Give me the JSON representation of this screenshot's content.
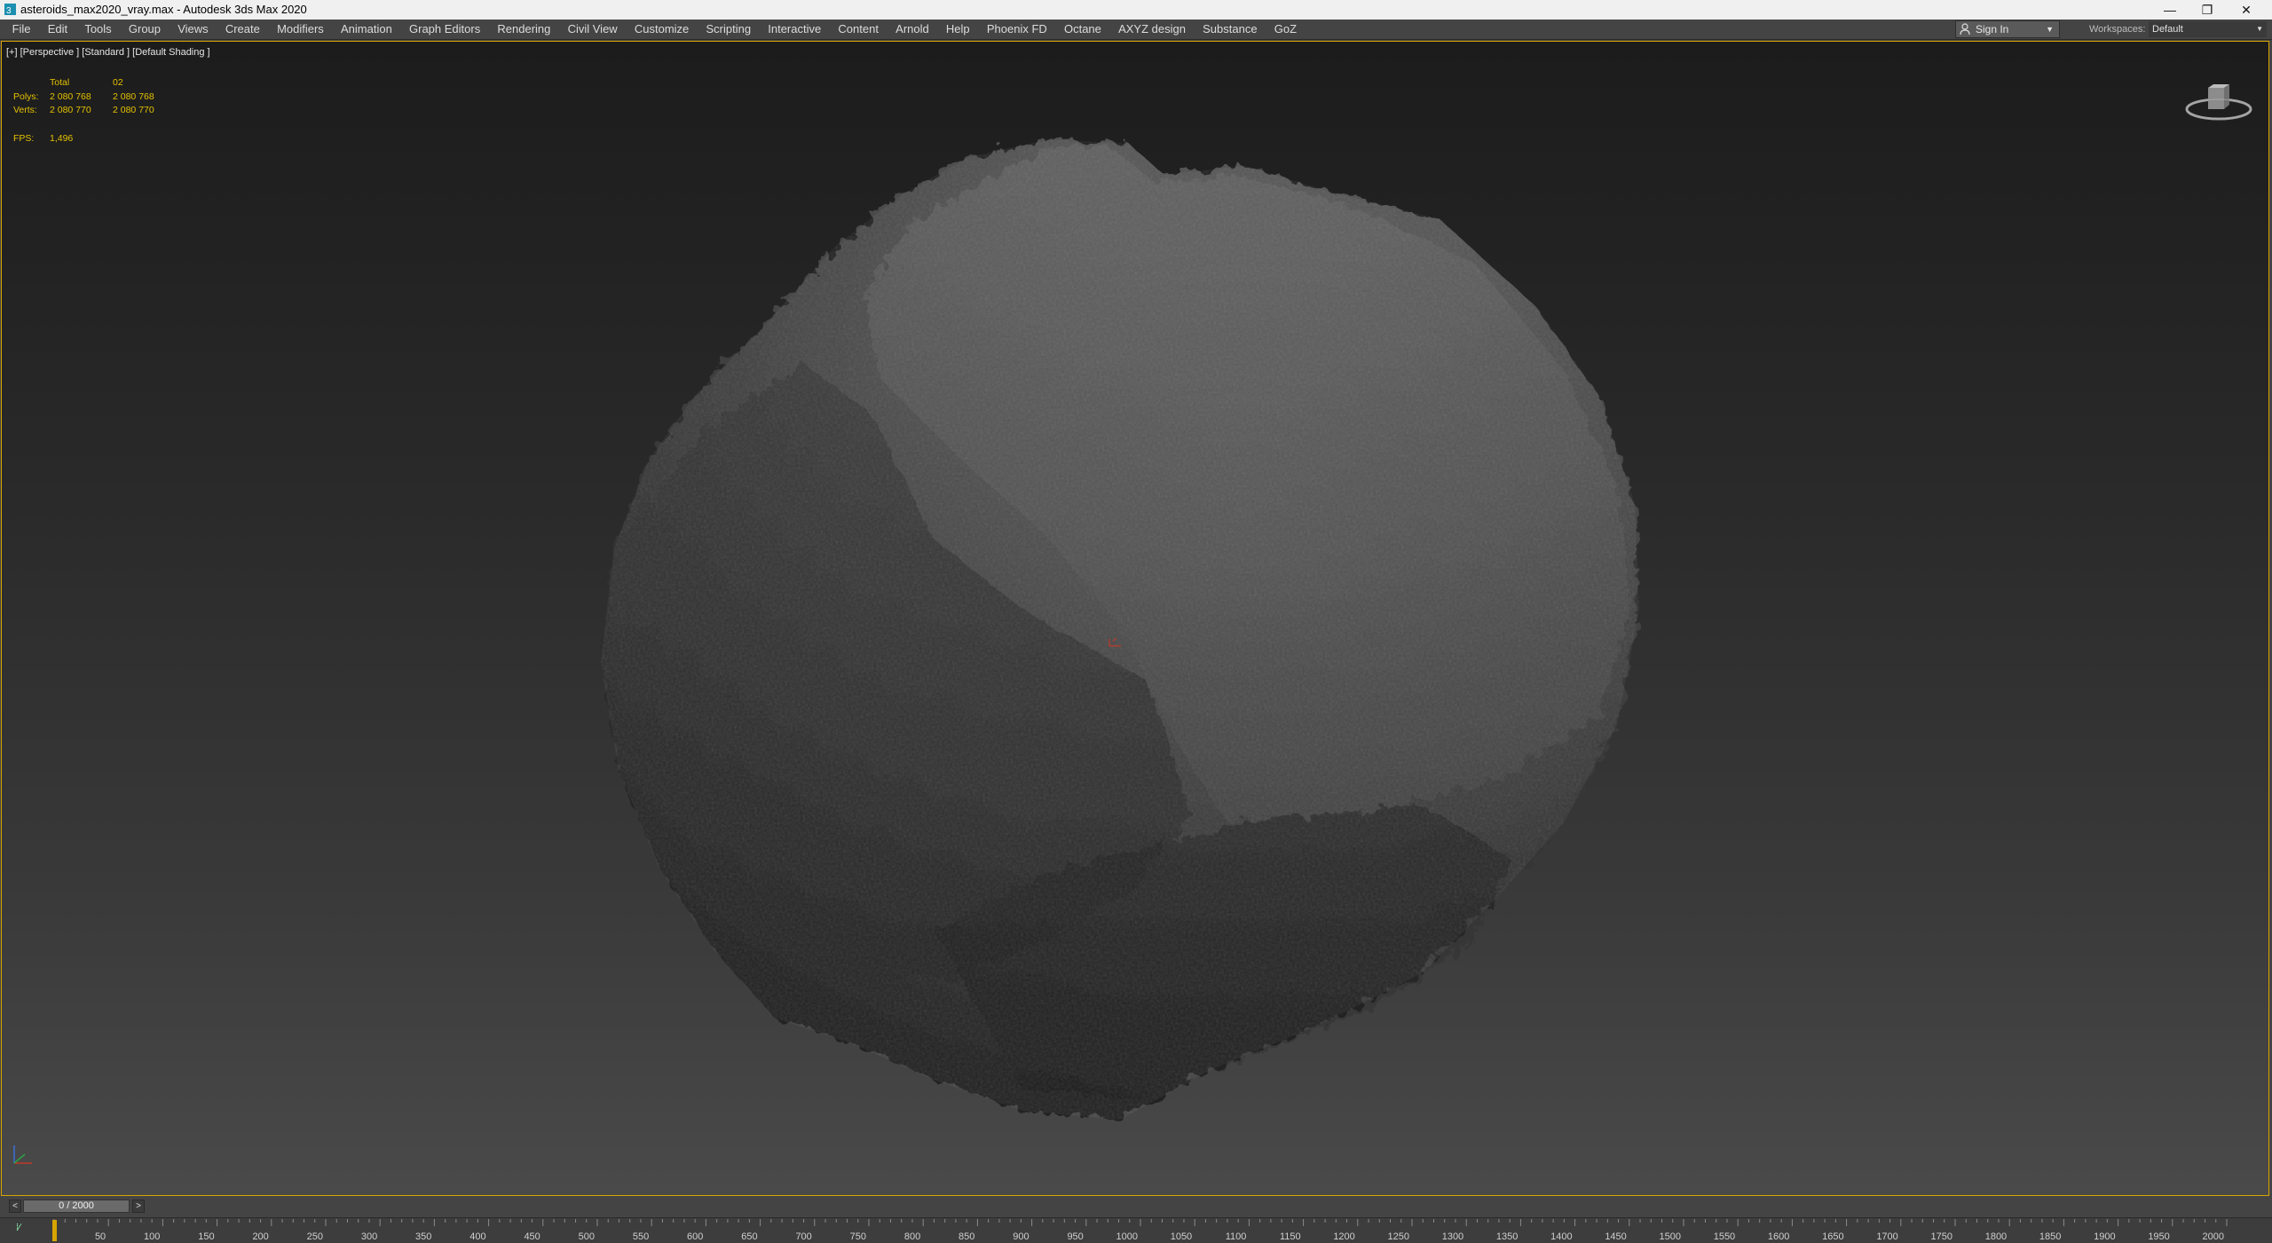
{
  "window": {
    "title": "asteroids_max2020_vray.max - Autodesk 3ds Max 2020",
    "controls": {
      "minimize": "—",
      "restore": "❐",
      "close": "✕"
    }
  },
  "menubar": {
    "items": [
      "File",
      "Edit",
      "Tools",
      "Group",
      "Views",
      "Create",
      "Modifiers",
      "Animation",
      "Graph Editors",
      "Rendering",
      "Civil View",
      "Customize",
      "Scripting",
      "Interactive",
      "Content",
      "Arnold",
      "Help",
      "Phoenix FD",
      "Octane",
      "AXYZ design",
      "Substance",
      "GoZ"
    ],
    "signin": {
      "label": "Sign In",
      "icon": "user-icon"
    },
    "workspaces": {
      "label": "Workspaces:",
      "value": "Default"
    }
  },
  "viewport": {
    "label": "[+] [Perspective ] [Standard ] [Default Shading ]",
    "stats": {
      "header_total": "Total",
      "header_object": "02",
      "polys_label": "Polys:",
      "polys_total": "2 080 768",
      "polys_object": "2 080 768",
      "verts_label": "Verts:",
      "verts_total": "2 080 770",
      "verts_object": "2 080 770",
      "fps_label": "FPS:",
      "fps_value": "1,496"
    },
    "colors": {
      "border": "#d7a400",
      "stats": "#e5c100",
      "rock": "#555555"
    }
  },
  "timeslider": {
    "prev": "<",
    "next": ">",
    "value_text": "0 / 2000",
    "current": 0,
    "total": 2000
  },
  "trackbar": {
    "icon": "key-filter-icon",
    "labels": [
      "50",
      "100",
      "150",
      "200",
      "250",
      "300",
      "350",
      "400",
      "450",
      "500",
      "550",
      "600",
      "650",
      "700",
      "750",
      "800",
      "850",
      "900",
      "950",
      "1000",
      "1050",
      "1100",
      "1150",
      "1200",
      "1250",
      "1300",
      "1350",
      "1400",
      "1450",
      "1500",
      "1550",
      "1600",
      "1650",
      "1700",
      "1750",
      "1800",
      "1850",
      "1900",
      "1950",
      "2000"
    ]
  }
}
